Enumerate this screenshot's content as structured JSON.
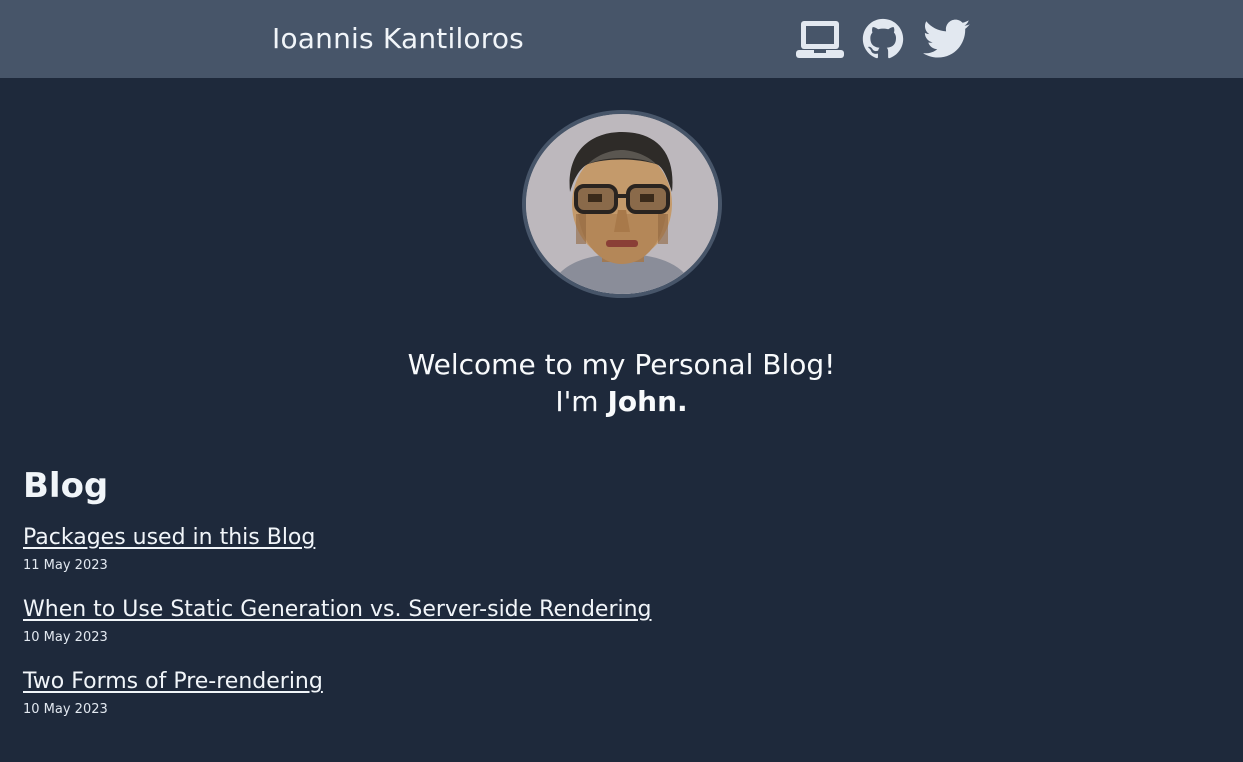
{
  "header": {
    "site_title": "Ioannis Kantiloros",
    "icons": [
      {
        "name": "laptop-icon",
        "label": "Portfolio"
      },
      {
        "name": "github-icon",
        "label": "GitHub"
      },
      {
        "name": "twitter-icon",
        "label": "Twitter"
      }
    ],
    "background": "#475569"
  },
  "intro": {
    "line1": "Welcome to my Personal Blog!",
    "line2_prefix": "I'm ",
    "name": "John."
  },
  "blog": {
    "heading": "Blog",
    "posts": [
      {
        "title": "Packages used in this Blog",
        "date": "11 May 2023"
      },
      {
        "title": "When to Use Static Generation vs. Server-side Rendering",
        "date": "10 May 2023"
      },
      {
        "title": "Two Forms of Pre-rendering",
        "date": "10 May 2023"
      }
    ]
  },
  "colors": {
    "page_background": "#1e293b",
    "header_background": "#475569",
    "text": "#f1f5f9"
  }
}
